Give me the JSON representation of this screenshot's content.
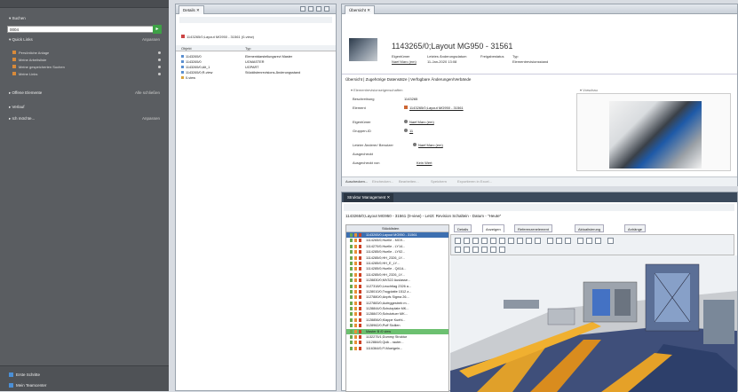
{
  "sidebar": {
    "search_header": "▾ Suchen",
    "search_value": "0004",
    "sections": [
      {
        "label": "▾ Quick Links",
        "right": "Anpassen"
      },
      {
        "label": "▸ Offene Elemente",
        "right": "Alle schließen"
      },
      {
        "label": "▸ Verlauf",
        "right": ""
      },
      {
        "label": "▸ Ich möchte...",
        "right": "Anpassen"
      }
    ],
    "quick_links": [
      "Persönliche Anlage",
      "Meine Arbeitsliste",
      "Meine gespeicherten Suchen",
      "Meine Links"
    ],
    "bottom_items": [
      "Erste Schritte",
      "Mein Teamcenter"
    ]
  },
  "details": {
    "tab": "Details",
    "breadcrumb": "1143265/0;Layout MG950 - 31561 (0-view)",
    "col1": "Objekt",
    "col2": "Typ",
    "rows": [
      {
        "obj": "1143265/0",
        "type": "Elementdarstellungsrevi Master"
      },
      {
        "obj": "1143265/0",
        "type": "UGMASTER"
      },
      {
        "obj": "1143265/0;Alt_1",
        "type": "UGPART"
      },
      {
        "obj": "1143265/0;R-view",
        "type": "Stücklistenrevisions-Änderungsstand"
      },
      {
        "obj": "0-view",
        "type": ""
      }
    ]
  },
  "overview": {
    "tab": "Übersicht",
    "title": "1143265/0;Layout MG950 - 31561",
    "meta_owner_lbl": "Eigentümer",
    "meta_owner": "Naef Marc (em)",
    "meta_date_lbl": "Letztes Änderungsdatum",
    "meta_date": "11-Jan-2020 13:08",
    "meta_release_lbl": "Freigabestatus",
    "meta_type_lbl": "Typ",
    "meta_type": "Elementrevisionsstand",
    "tabs": "Übersicht | Zugehörige Datensätze | Verfügbare Änderungen/Verbände",
    "section": "▾ Elementrevisionseigenschaften",
    "preview_label": "▾ Vorschau",
    "fields": [
      {
        "label": "Beschreibung",
        "value": "1143265"
      },
      {
        "label": "Element",
        "value": "1143265/0;Layout MG950 - 31561"
      },
      {
        "label": "Eigentümer",
        "value": "Naef Marc (em)"
      },
      {
        "label": "Gruppen-ID",
        "value": "11"
      },
      {
        "label": "Letzter Änderer/ Benutzer",
        "value": "Naef Marc (em)"
      },
      {
        "label": "Ausgecheckt",
        "value": ""
      },
      {
        "label": "Ausgecheckt von",
        "value": "Kein Wert"
      }
    ],
    "toolbar": [
      "Auschecken...",
      "Einchecken...",
      "Bearbeiten...",
      "Speichern",
      "Exportieren in Excel..."
    ]
  },
  "struct": {
    "tab": "Struktur Management",
    "breadcrumb": "1143265/0;Layout MG950 - 31561 (0-view) - Letzt: Revision Schaltein - Datum - \"Heute\"",
    "tree_header": "Stücklisten",
    "tree_rows": [
      "1143265/0;Layout MG950 - 31561",
      "1114265/0;Huelle - MG9...",
      "1114270/0;Huelle - LY14...",
      "1114285/0;Huelle - LY02...",
      "1114285/0;HH_2326_LY...",
      "1114285/0;HH_E_LY...",
      "1114285/0;Huelle - Q41A...",
      "1114285/0;HH_2326_LY...",
      "1128830/0;MV322 Auslasse...",
      "1127318/0;Leuchtlag 2326 a...",
      "1128010/0;Trogplatte 1512 z...",
      "1127880/0;Anpfs Sigma 26...",
      "1127883/0;Aufeggestreb m...",
      "1128844/0;Schutzplate MK...",
      "1128847/0;Schutztuer MK...",
      "1128856/0;Klappe Kuehl...",
      "1128962/0;Puff Sicilien",
      "Master B /0 view",
      "1132275/1;Dummy Struktur",
      "1112884/0;Quik - rauter...",
      "1116364/0;Fl.Moeigeln..."
    ],
    "view_tabs": [
      "Details",
      "Anzeigen",
      "Referenzenelement",
      "Aktualisierung",
      "Anhänge"
    ]
  }
}
